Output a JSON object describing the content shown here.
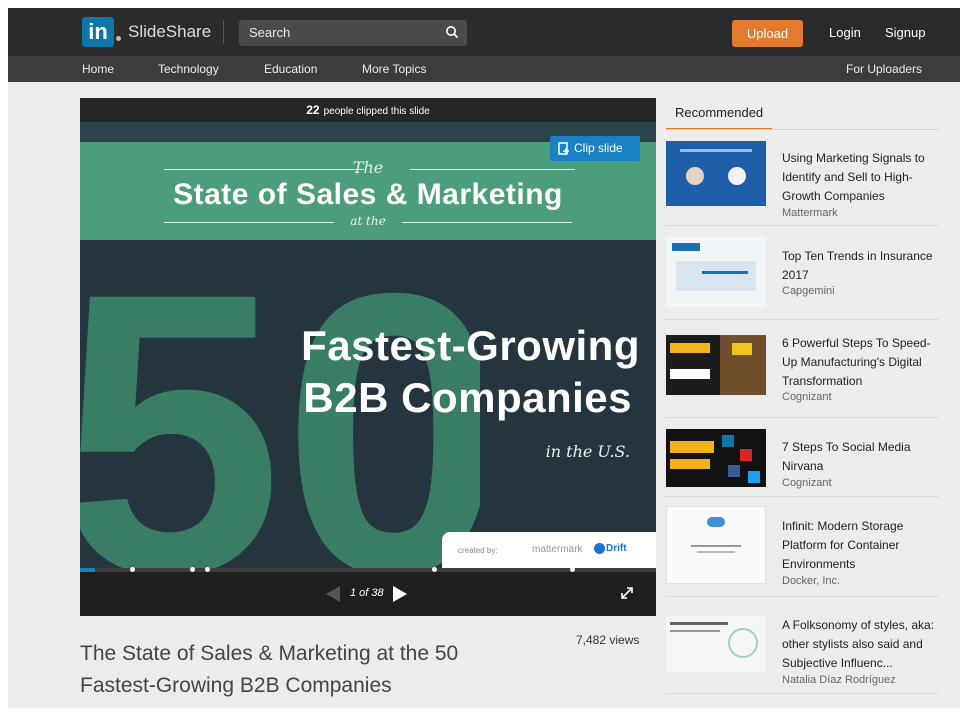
{
  "header": {
    "logo_text": "in",
    "brand": "SlideShare",
    "search_placeholder": "Search",
    "upload_label": "Upload",
    "login_label": "Login",
    "signup_label": "Signup"
  },
  "nav": {
    "items": [
      "Home",
      "Technology",
      "Education",
      "More Topics"
    ],
    "for_uploaders": "For Uploaders"
  },
  "player": {
    "clipped_count": "22",
    "clipped_text": "people clipped this slide",
    "clip_button": "Clip slide",
    "page_indicator": "1 of 38",
    "progress_fraction": 0.026,
    "progress_dots": [
      0.09,
      0.195,
      0.22,
      0.615,
      0.855
    ]
  },
  "slide": {
    "the": "The",
    "main": "State of Sales & Marketing",
    "at_the": "at the",
    "big_number": "50",
    "line1": "Fastest-Growing",
    "line2": "B2B Companies",
    "in_us": "in the U.S.",
    "created_by": "created by:",
    "brand1": "mattermark",
    "brand2": "Drift"
  },
  "document": {
    "views": "7,482 views",
    "title": "The State of Sales & Marketing at the 50 Fastest-Growing B2B Companies"
  },
  "recommended": {
    "tab_label": "Recommended",
    "items": [
      {
        "title": "Using Marketing Signals to Identify and Sell to High-Growth Companies",
        "author": "Mattermark"
      },
      {
        "title": "Top Ten Trends in Insurance 2017",
        "author": "Capgemini"
      },
      {
        "title": "6 Powerful Steps To Speed-Up Manufacturing's Digital Transformation",
        "author": "Cognizant"
      },
      {
        "title": "7 Steps To Social Media Nirvana",
        "author": "Cognizant"
      },
      {
        "title": "Infinit: Modern Storage Platform for Container Environments",
        "author": "Docker, Inc."
      },
      {
        "title": "A Folksonomy of styles, aka: other stylists also said and Subjective Influenc...",
        "author": "Natalia Díaz Rodríguez"
      }
    ]
  },
  "colors": {
    "accent": "#e37b2e",
    "link_blue": "#1a82c4",
    "slide_green": "#4c9d7c"
  }
}
